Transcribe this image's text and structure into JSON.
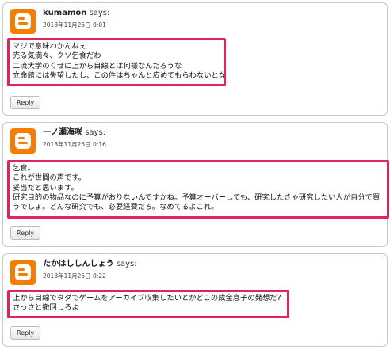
{
  "comments": [
    {
      "author": "kumamon",
      "says": "says:",
      "timestamp": "2013年11月25日 0:01",
      "lines": [
        "マジで意味わかんねぇ",
        "売る気満々、クソ乞食だわ",
        "二流大学のくせに上から目線とは何様なんだろうな",
        "立命館には失望したし、この件はちゃんと広めてもらわないとな"
      ],
      "reply_label": "Reply"
    },
    {
      "author": "一ノ瀬海咲",
      "says": "says:",
      "timestamp": "2013年11月25日 0:16",
      "lines": [
        "乞食。",
        "これが世間の声です。",
        "妥当だと思います。",
        "研究目的の物品なのに予算がおりないんですかね。予算オーバーしても、研究したきゃ研究したい人が自分で買",
        "うでしょ。どんな研究でも、必要経費だろ。なめてるよこれ。"
      ],
      "reply_label": "Reply"
    },
    {
      "author": "たかはししんしょう",
      "says": "says:",
      "timestamp": "2013年11月25日 0:22",
      "lines": [
        "上から目線でタダでゲームをアーカイブ収集したいとかどこの成金息子の発想だ?",
        "さっさと撤回しろよ"
      ],
      "reply_label": "Reply"
    }
  ],
  "colors": {
    "highlight_border": "#e0245e",
    "avatar_bg": "#f57d00"
  },
  "icons": {
    "avatar": "blogger-logo-icon"
  }
}
